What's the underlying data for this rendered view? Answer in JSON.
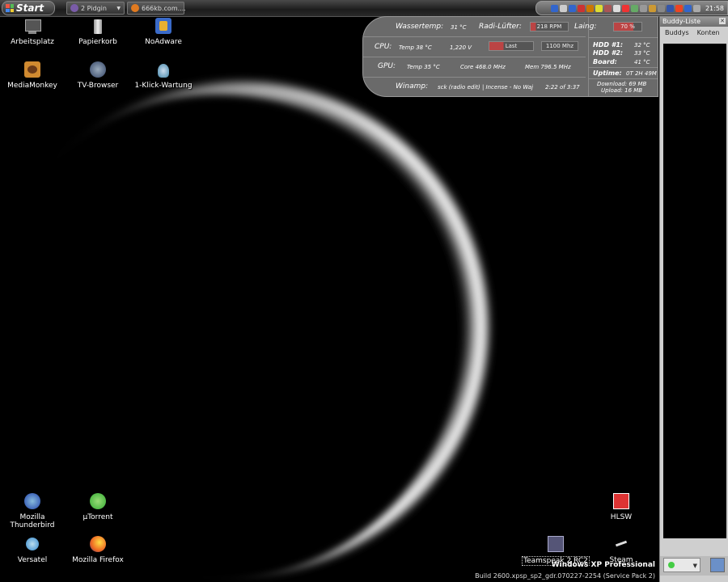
{
  "taskbar": {
    "start_label": "Start",
    "tasks": [
      {
        "label": "2 Pidgin",
        "color": "#7a5ca8"
      },
      {
        "label": "666kb.com....",
        "color": "#e07a20"
      }
    ],
    "clock": "21:58"
  },
  "desktop": {
    "icons": [
      {
        "label": "Arbeitsplatz"
      },
      {
        "label": "Papierkorb"
      },
      {
        "label": "NoAdware"
      },
      {
        "label": "MediaMonkey"
      },
      {
        "label": "TV-Browser"
      },
      {
        "label": "1-Klick-Wartung"
      },
      {
        "label": "Mozilla Thunderbird"
      },
      {
        "label": "µTorrent"
      },
      {
        "label": "Versatel"
      },
      {
        "label": "Mozilla Firefox"
      },
      {
        "label": "HLSW"
      },
      {
        "label": "Teamspeak 2 RC2"
      },
      {
        "label": "Steam"
      }
    ]
  },
  "panel": {
    "wassertemp_label": "Wassertemp:",
    "wassertemp_value": "31 °C",
    "radi_label": "Radi-Lüfter:",
    "radi_value": "218 RPM",
    "laing_label": "Laing:",
    "laing_value": "70 %",
    "cpu_label": "CPU:",
    "cpu_temp": "Temp 38 °C",
    "cpu_volt": "1,220 V",
    "cpu_last": "Last",
    "cpu_mhz": "1100 Mhz",
    "gpu_label": "GPU:",
    "gpu_temp": "Temp 35 °C",
    "gpu_core": "Core 468.0 MHz",
    "gpu_mem": "Mem 796.5 MHz",
    "winamp_label": "Winamp:",
    "winamp_track": "sck (radio edit) | Incense - No Waj",
    "winamp_time": "2:22 of 3:37",
    "hdd1_label": "HDD #1:",
    "hdd1_value": "32 °C",
    "hdd2_label": "HDD #2:",
    "hdd2_value": "33 °C",
    "board_label": "Board:",
    "board_value": "41 °C",
    "uptime_label": "Uptime:",
    "uptime_value": "0T 2H 49M",
    "download": "Download: 69 MB",
    "upload": "Upload: 16 MB"
  },
  "buddy": {
    "title": "Buddy-Liste",
    "menu_buddys": "Buddys",
    "menu_konten": "Konten"
  },
  "watermark": {
    "line1": "Windows XP Professional",
    "line2": "Build 2600.xpsp_sp2_gdr.070227-2254 (Service Pack 2)"
  }
}
